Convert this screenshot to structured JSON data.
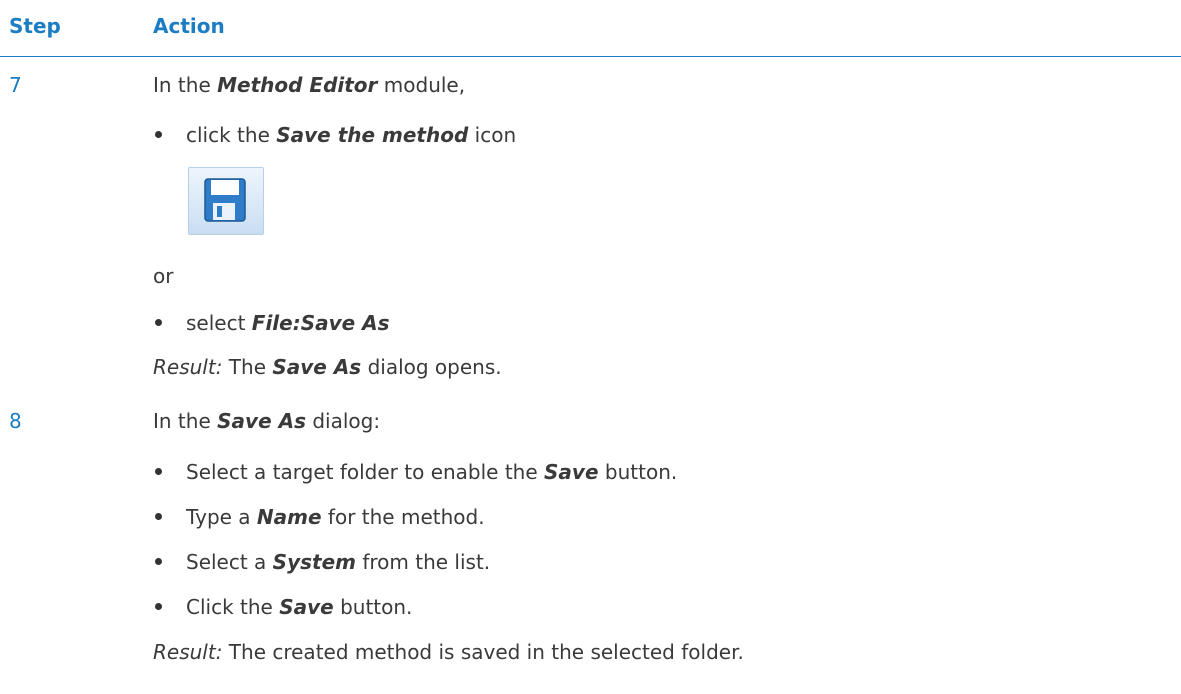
{
  "table": {
    "header": {
      "step": "Step",
      "action": "Action"
    },
    "rows": [
      {
        "step": "7",
        "intro": {
          "pre": "In the ",
          "em": "Method Editor",
          "post": " module,"
        },
        "bullet1": {
          "pre": "click the ",
          "em": "Save the method",
          "post": " icon"
        },
        "icon": "save-floppy-icon",
        "or": "or",
        "bullet2": {
          "pre": "select ",
          "em": "File:Save As",
          "post": ""
        },
        "result": {
          "label": "Result:",
          "pre": " The ",
          "em": "Save As",
          "post": " dialog opens."
        }
      },
      {
        "step": "8",
        "intro": {
          "pre": "In the ",
          "em": "Save As",
          "post": " dialog:"
        },
        "bullets": [
          {
            "pre": "Select a target folder to enable the ",
            "em": "Save",
            "post": " button."
          },
          {
            "pre": "Type a ",
            "em": "Name",
            "post": " for the method."
          },
          {
            "pre": "Select a ",
            "em": "System",
            "post": " from the list."
          },
          {
            "pre": "Click the ",
            "em": "Save",
            "post": " button."
          }
        ],
        "result": {
          "label": "Result:",
          "text": " The created method is saved in the selected folder."
        }
      }
    ]
  },
  "colors": {
    "accent": "#1b7dc3",
    "text": "#3a3a3a"
  }
}
